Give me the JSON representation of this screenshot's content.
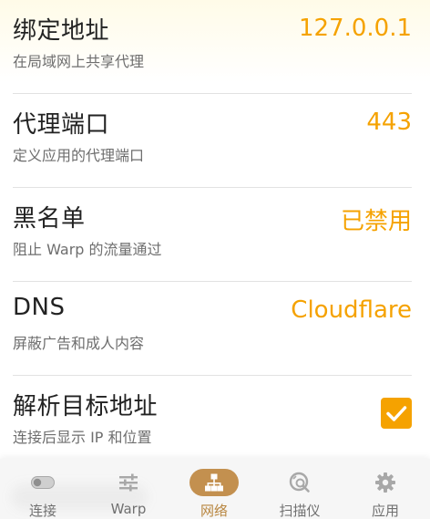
{
  "settings": [
    {
      "title": "绑定地址",
      "subtitle": "在局域网上共享代理",
      "value": "127.0.0.1"
    },
    {
      "title": "代理端口",
      "subtitle": "定义应用的代理端口",
      "value": "443"
    },
    {
      "title": "黑名单",
      "subtitle": "阻止 Warp 的流量通过",
      "value": "已禁用"
    },
    {
      "title": "DNS",
      "subtitle": "屏蔽广告和成人内容",
      "value": "Cloudflare"
    },
    {
      "title": "解析目标地址",
      "subtitle": "连接后显示 IP 和位置",
      "checked": true
    }
  ],
  "nav": {
    "items": [
      {
        "label": "连接",
        "icon": "toggle-icon",
        "active": false
      },
      {
        "label": "Warp",
        "icon": "sliders-icon",
        "active": false
      },
      {
        "label": "网络",
        "icon": "network-icon",
        "active": true
      },
      {
        "label": "扫描仪",
        "icon": "scanner-icon",
        "active": false
      },
      {
        "label": "应用",
        "icon": "gear-icon",
        "active": false
      }
    ]
  },
  "colors": {
    "accent": "#f5a200",
    "nav_active": "#c3904f",
    "nav_inactive": "#707070"
  }
}
